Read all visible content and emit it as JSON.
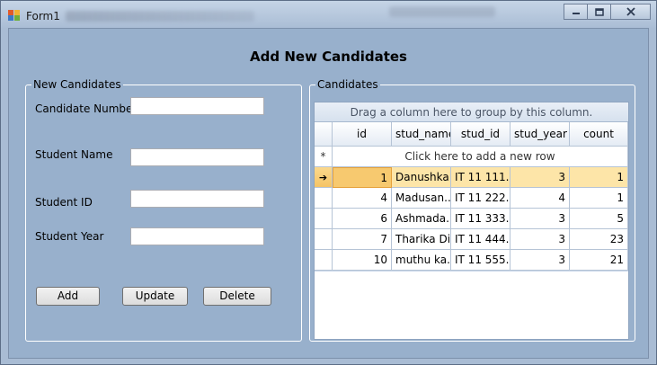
{
  "window": {
    "title": "Form1",
    "controls": [
      "minimize-icon",
      "maximize-icon",
      "close-icon"
    ]
  },
  "form": {
    "heading": "Add New Candidates",
    "new_group_title": "New Candidates",
    "labels": {
      "candidate_number": "Candidate Number",
      "student_name": "Student Name",
      "student_id": "Student ID",
      "student_year": "Student Year"
    },
    "values": {
      "candidate_number": "",
      "student_name": "",
      "student_id": "",
      "student_year": ""
    },
    "buttons": {
      "add": "Add",
      "update": "Update",
      "delete": "Delete"
    }
  },
  "grid": {
    "group_title": "Candidates",
    "group_panel_text": "Drag a column here to group by this column.",
    "new_row_text": "Click here to add a new row",
    "new_row_marker": "*",
    "current_row_marker": "➔",
    "columns": [
      "id",
      "stud_name",
      "stud_id",
      "stud_year",
      "count"
    ],
    "rows": [
      {
        "id": "1",
        "stud_name": "Danushka...",
        "stud_id": "IT 11 111...",
        "stud_year": "3",
        "count": "1"
      },
      {
        "id": "4",
        "stud_name": "Madusan...",
        "stud_id": "IT 11 222...",
        "stud_year": "4",
        "count": "1"
      },
      {
        "id": "6",
        "stud_name": "Ashmada...",
        "stud_id": "IT 11 333...",
        "stud_year": "3",
        "count": "5"
      },
      {
        "id": "7",
        "stud_name": "Tharika Di...",
        "stud_id": "IT 11 444...",
        "stud_year": "3",
        "count": "23"
      },
      {
        "id": "10",
        "stud_name": "muthu ka...",
        "stud_id": "IT 11 555...",
        "stud_year": "3",
        "count": "21"
      }
    ],
    "selected_row_index": 0
  },
  "colors": {
    "form_background": "#98b0cc",
    "selected_row": "#fde5a8",
    "current_cell": "#f7c96f"
  }
}
